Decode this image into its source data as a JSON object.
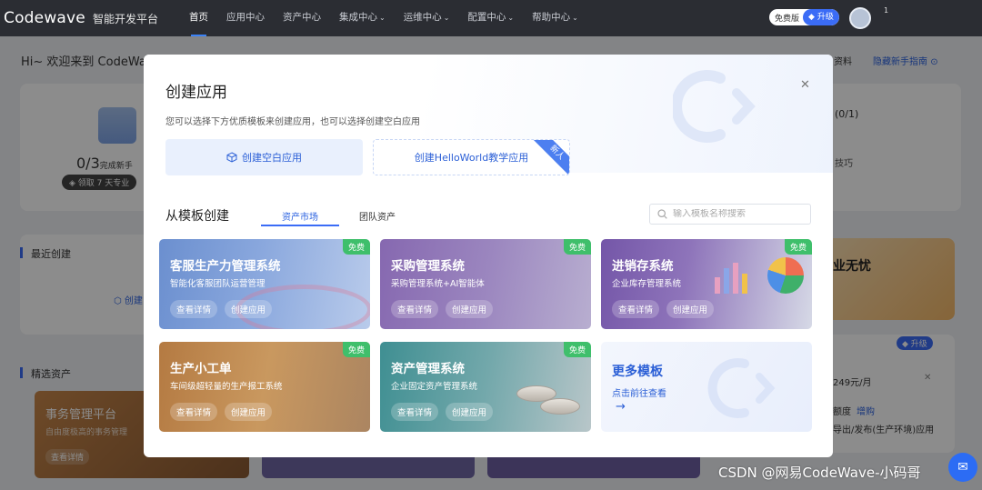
{
  "topbar": {
    "logo": "Codewave",
    "logo_sub": "智能开发平台",
    "nav": [
      {
        "label": "首页",
        "dropdown": false,
        "active": true
      },
      {
        "label": "应用中心",
        "dropdown": false
      },
      {
        "label": "资产中心",
        "dropdown": false
      },
      {
        "label": "集成中心",
        "dropdown": true
      },
      {
        "label": "运维中心",
        "dropdown": true
      },
      {
        "label": "配置中心",
        "dropdown": true
      },
      {
        "label": "帮助中心",
        "dropdown": true
      }
    ],
    "plan_label": "免费版",
    "upgrade_label": "升级",
    "user_name": "1"
  },
  "background": {
    "greeting": "Hi~ 欢迎来到 CodeWa",
    "profile_link": "资料",
    "guide_link": "隐藏新手指南",
    "progress": "0/3",
    "progress_suffix": "完成新手",
    "vip_label": "领取 7 天专业",
    "count": "(0/1)",
    "tip": "技巧",
    "recent_title": "最近创建",
    "recent_create": "创建",
    "featured_title": "精选资产",
    "promo": "业无忧",
    "upgrade2": "升级",
    "price": "249元/月",
    "quota": "额度",
    "quota_add": "增购",
    "export": "导出/发布(生产环境)应用",
    "tile1_title": "事务管理平台",
    "tile1_sub": "自由度极高的事务管理",
    "tile1_btn": "查看详情",
    "watermark": "CSDN @网易CodeWave-小码哥"
  },
  "modal": {
    "title": "创建应用",
    "description": "您可以选择下方优质模板来创建应用，也可以选择创建空白应用",
    "create_blank": "创建空白应用",
    "create_helloworld": "创建HelloWorld教学应用",
    "new_badge": "新人",
    "templates_title": "从模板创建",
    "tabs": [
      {
        "label": "资产市场",
        "active": true
      },
      {
        "label": "团队资产",
        "active": false
      }
    ],
    "search_placeholder": "输入模板名称搜索",
    "templates": [
      {
        "title": "客服生产力管理系统",
        "subtitle": "智能化客服团队运营管理",
        "badge": "免费",
        "detail": "查看详情",
        "create": "创建应用"
      },
      {
        "title": "采购管理系统",
        "subtitle": "采购管理系统+AI智能体",
        "badge": "免费",
        "detail": "查看详情",
        "create": "创建应用"
      },
      {
        "title": "进销存系统",
        "subtitle": "企业库存管理系统",
        "badge": "免费",
        "detail": "查看详情",
        "create": "创建应用"
      },
      {
        "title": "生产小工单",
        "subtitle": "车间级超轻量的生产报工系统",
        "badge": "免费",
        "detail": "查看详情",
        "create": "创建应用"
      },
      {
        "title": "资产管理系统",
        "subtitle": "企业固定资产管理系统",
        "badge": "免费",
        "detail": "查看详情",
        "create": "创建应用"
      }
    ],
    "more": {
      "title": "更多模板",
      "subtitle": "点击前往查看",
      "arrow": "→"
    }
  },
  "colors": {
    "accent": "#3b6cf6",
    "free_badge": "#3fbf6b",
    "topbar": "#2b2d33"
  }
}
